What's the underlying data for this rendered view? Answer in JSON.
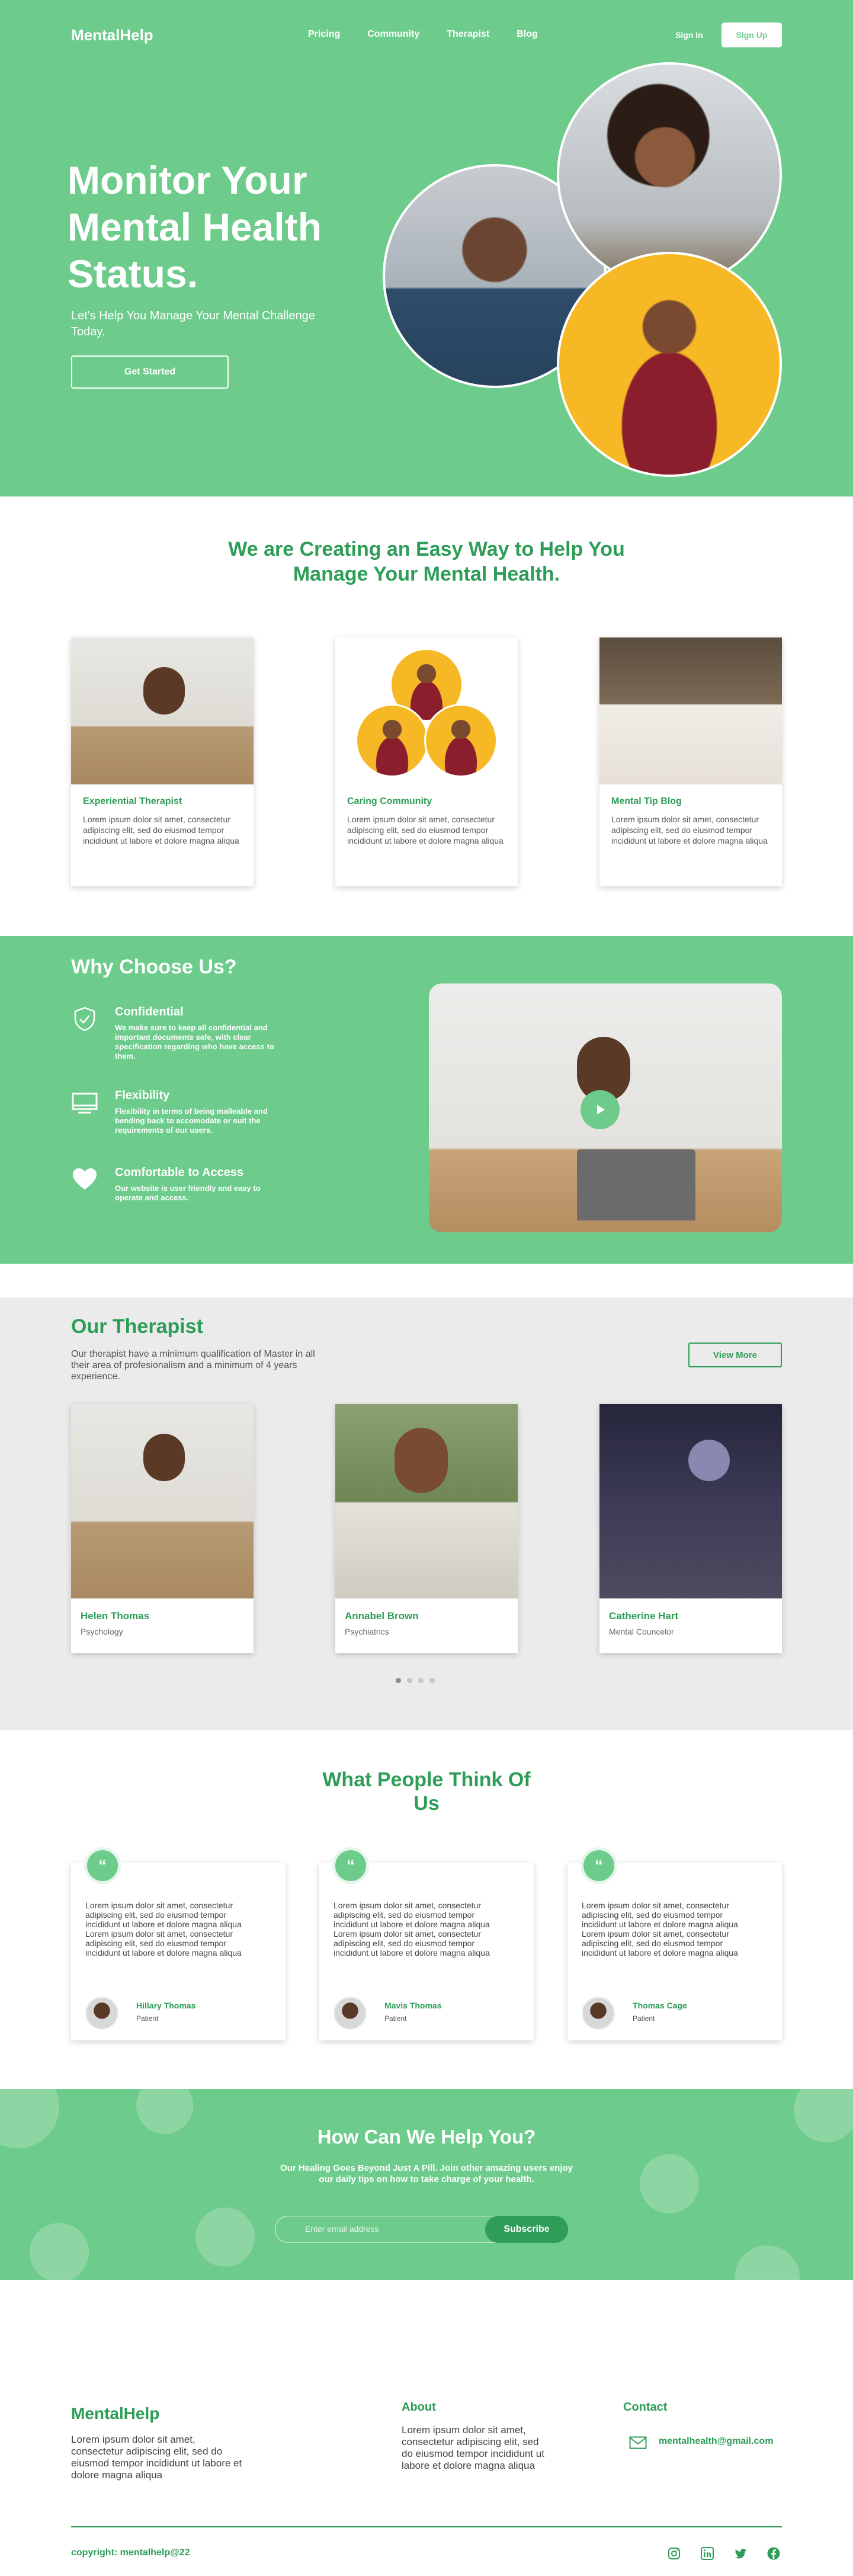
{
  "nav": {
    "logo": "MentalHelp",
    "links": [
      "Pricing",
      "Community",
      "Therapist",
      "Blog"
    ],
    "sign_in": "Sign In",
    "sign_up": "Sign Up"
  },
  "hero": {
    "title": "Monitor Your Mental Health Status.",
    "subtitle": "Let's Help You Manage Your Mental Challenge Today.",
    "cta": "Get Started"
  },
  "features": {
    "heading": "We are Creating an Easy Way to Help You Manage Your Mental Health.",
    "cards": [
      {
        "title": "Experiential Therapist",
        "text": "Lorem ipsum dolor sit amet, consectetur adipiscing elit, sed do eiusmod tempor incididunt ut labore et dolore magna aliqua"
      },
      {
        "title": "Caring Community",
        "text": "Lorem ipsum dolor sit amet, consectetur adipiscing elit, sed do eiusmod tempor incididunt ut labore et dolore magna aliqua"
      },
      {
        "title": "Mental Tip Blog",
        "text": "Lorem ipsum dolor sit amet, consectetur adipiscing elit, sed do eiusmod tempor incididunt ut labore et dolore magna aliqua"
      }
    ]
  },
  "why": {
    "title": "Why Choose Us?",
    "items": [
      {
        "title": "Confidential",
        "text": "We make sure to keep all confidential and important documents safe, with clear specification regarding who have access to them.",
        "icon": "shield-check-icon"
      },
      {
        "title": "Flexibility",
        "text": "Flexibility in terms of being malleable and bending back to accomodate or suit the requirements of our users.",
        "icon": "monitor-icon"
      },
      {
        "title": "Comfortable to  Access",
        "text": "Our website is user friendly and easy to operate and access.",
        "icon": "heart-icon"
      }
    ]
  },
  "therapist": {
    "title": "Our Therapist",
    "description": "Our therapist have a minimum qualification of Master in all their area of profesionalism and a minimum of 4 years experience.",
    "view_more": "View More",
    "cards": [
      {
        "name": "Helen Thomas",
        "role": "Psychology"
      },
      {
        "name": "Annabel Brown",
        "role": "Psychiatrics"
      },
      {
        "name": "Catherine Hart",
        "role": "Mental Councelor"
      }
    ]
  },
  "testimonials": {
    "heading": "What People Think Of Us",
    "quote_mark": "“",
    "cards": [
      {
        "text": "Lorem ipsum dolor sit amet, consectetur adipiscing elit, sed do eiusmod tempor incididunt ut labore et dolore magna aliqua Lorem ipsum dolor sit amet, consectetur adipiscing elit, sed do eiusmod tempor incididunt ut labore et dolore magna aliqua",
        "name": "Hillary Thomas",
        "role": "Patient"
      },
      {
        "text": "Lorem ipsum dolor sit amet, consectetur adipiscing elit, sed do eiusmod tempor incididunt ut labore et dolore magna aliqua Lorem ipsum dolor sit amet, consectetur adipiscing elit, sed do eiusmod tempor incididunt ut labore et dolore magna aliqua",
        "name": "Mavis Thomas",
        "role": "Patient"
      },
      {
        "text": "Lorem ipsum dolor sit amet, consectetur adipiscing elit, sed do eiusmod tempor incididunt ut labore et dolore magna aliqua Lorem ipsum dolor sit amet, consectetur adipiscing elit, sed do eiusmod tempor incididunt ut labore et dolore magna aliqua",
        "name": "Thomas Cage",
        "role": "Patient"
      }
    ]
  },
  "newsletter": {
    "title": "How Can We Help You?",
    "subtitle": "Our Healing Goes Beyond Just A Pill.  Join other amazing users enjoy our daily tips on how to take charge of your health.",
    "placeholder": "Enter email address",
    "button": "Subscribe"
  },
  "footer": {
    "logo": "MentalHelp",
    "text": "Lorem ipsum dolor sit amet, consectetur adipiscing elit, sed do eiusmod tempor incididunt ut labore et dolore magna aliqua",
    "about_heading": "About",
    "about_text": "Lorem ipsum dolor sit amet, consectetur adipiscing elit, sed do eiusmod tempor incididunt ut labore et dolore magna aliqua",
    "contact_heading": "Contact",
    "email": "mentalhealth@gmail.com",
    "copyright": "copyright: mentalhelp@22",
    "socials": [
      "instagram-icon",
      "linkedin-icon",
      "twitter-icon",
      "facebook-icon"
    ]
  },
  "colors": {
    "primary_green": "#6dcb8b",
    "dark_green": "#2e9d57",
    "accent_yellow": "#f7b825",
    "gray_bg": "#ebebeb"
  }
}
